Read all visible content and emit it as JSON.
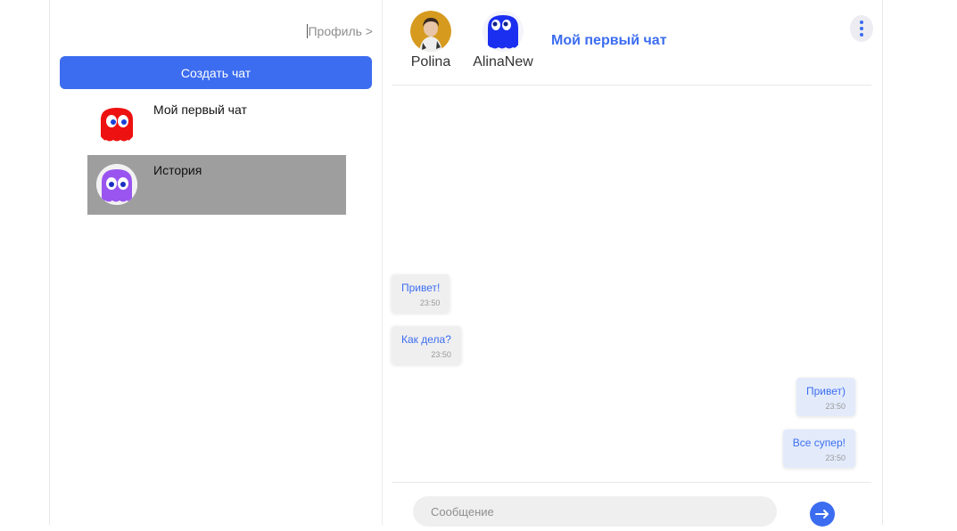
{
  "sidebar": {
    "profile_link": "Профиль >",
    "create_chat_label": "Создать чат",
    "chats": [
      {
        "name": "Мой первый чат",
        "avatar_icon": "red-ghost-icon",
        "active": false
      },
      {
        "name": "История",
        "avatar_icon": "purple-ghost-icon",
        "active": true
      }
    ]
  },
  "header": {
    "members": [
      {
        "name": "Polina",
        "avatar_icon": "user-photo-avatar"
      },
      {
        "name": "AlinaNew",
        "avatar_icon": "blue-ghost-icon"
      }
    ],
    "chat_title": "Мой первый чат",
    "menu_icon": "vertical-dots-icon"
  },
  "messages": [
    {
      "text": "Привет!",
      "time": "23:50",
      "mine": false
    },
    {
      "text": "Как дела?",
      "time": "23:50",
      "mine": false
    },
    {
      "text": "Привет)",
      "time": "23:50",
      "mine": true
    },
    {
      "text": "Все супер!",
      "time": "23:50",
      "mine": true
    }
  ],
  "composer": {
    "placeholder": "Сообщение",
    "send_icon": "arrow-right-icon"
  },
  "colors": {
    "accent": "#3c6df0",
    "active_chat_bg": "#9e9e9e",
    "incoming_bg": "#efefef",
    "outgoing_bg": "#e3ebfb"
  }
}
